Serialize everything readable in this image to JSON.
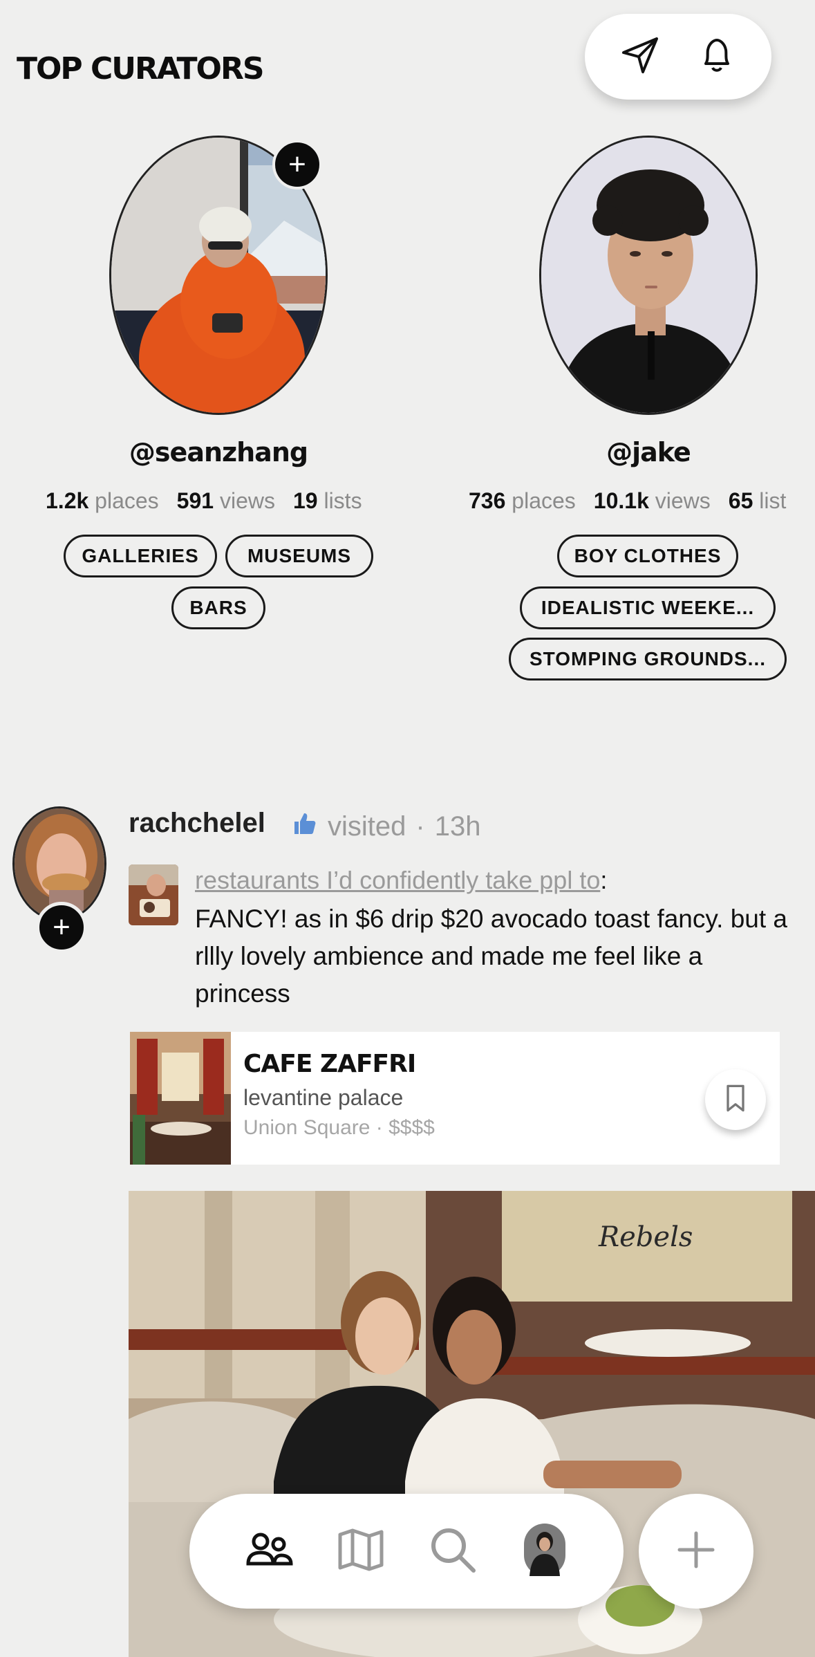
{
  "header": {
    "title": "TOP CURATORS",
    "icons": [
      "send-icon",
      "bell-icon"
    ]
  },
  "curators": [
    {
      "handle": "@seanzhang",
      "places_count": "1.2k",
      "places_label": "places",
      "views_count": "591",
      "views_label": "views",
      "lists_count": "19",
      "lists_label": "lists",
      "tags": [
        "GALLERIES",
        "MUSEUMS",
        "BARS"
      ],
      "follow_label": "+"
    },
    {
      "handle": "@jake",
      "places_count": "736",
      "places_label": "places",
      "views_count": "10.1k",
      "views_label": "views",
      "lists_count": "65",
      "lists_label": "list",
      "tags": [
        "BOY CLOTHES",
        "IDEALISTIC WEEKE...",
        "STOMPING GROUNDS..."
      ]
    }
  ],
  "feed": {
    "user": "rachchelel",
    "action": "visited",
    "separator": "·",
    "time": "13h",
    "list_name": "restaurants I’d confidently take ppl to",
    "list_colon": ":",
    "review": "FANCY! as in $6 drip $20 avocado toast fancy. but a rllly lovely ambience and made me feel like a princess",
    "follow_label": "+",
    "place": {
      "name": "CAFE ZAFFRI",
      "subtitle": "levantine palace",
      "location": "Union Square · $$$$"
    },
    "photo_sign": "Rebels"
  },
  "nav": {
    "items": [
      "people-icon",
      "map-icon",
      "search-icon",
      "profile-avatar"
    ],
    "add_label": "+"
  },
  "colors": {
    "background": "#efefee",
    "accent_black": "#0b0b0b",
    "muted_text": "#9a9a9a",
    "like_blue": "#5b8fd6"
  }
}
